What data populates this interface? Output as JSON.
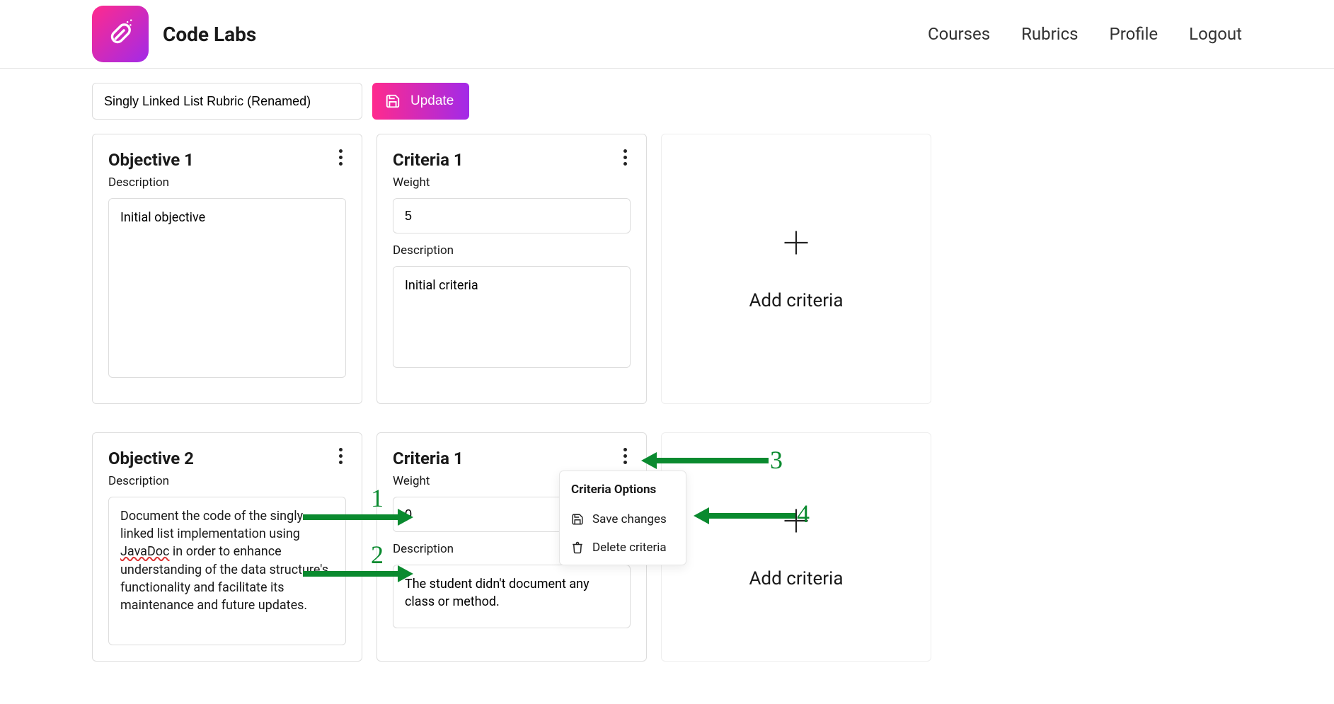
{
  "app": {
    "name": "Code Labs"
  },
  "nav": {
    "courses": "Courses",
    "rubrics": "Rubrics",
    "profile": "Profile",
    "logout": "Logout"
  },
  "rubric": {
    "name": "Singly Linked List Rubric (Renamed)",
    "update_label": "Update"
  },
  "rows": [
    {
      "objective": {
        "title": "Objective 1",
        "desc_label": "Description",
        "desc_value": "Initial objective"
      },
      "criteria": {
        "title": "Criteria 1",
        "weight_label": "Weight",
        "weight_value": "5",
        "desc_label": "Description",
        "desc_value": "Initial criteria"
      },
      "add_label": "Add criteria"
    },
    {
      "objective": {
        "title": "Objective 2",
        "desc_label": "Description",
        "desc_prefix": "Document the code of the singly linked list implementation using ",
        "desc_javadoc": "JavaDoc",
        "desc_suffix": " in order to enhance understanding of the data structure's functionality and facilitate its maintenance and future updates."
      },
      "criteria": {
        "title": "Criteria 1",
        "weight_label": "Weight",
        "weight_value": "0",
        "desc_label": "Description",
        "desc_value": "The student didn't document any class or method."
      },
      "add_label": "Add criteria"
    }
  ],
  "popover": {
    "title": "Criteria Options",
    "save": "Save changes",
    "delete": "Delete criteria"
  },
  "annotations": {
    "n1": "1",
    "n2": "2",
    "n3": "3",
    "n4": "4"
  }
}
